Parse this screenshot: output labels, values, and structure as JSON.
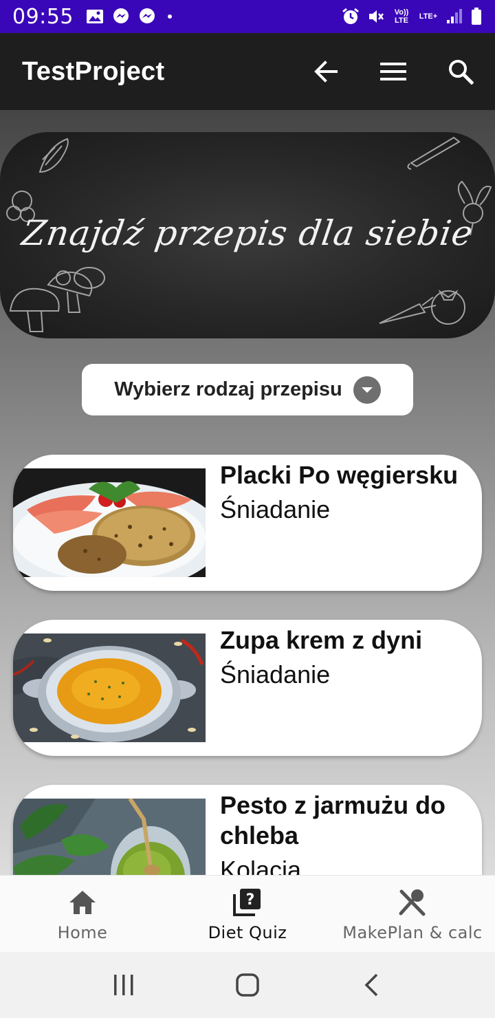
{
  "status_bar": {
    "time": "09:55",
    "network_volte": "Vo)) LTE",
    "network_lte": "LTE+"
  },
  "app_bar": {
    "title": "TestProject",
    "actions": [
      "back-arrow-icon",
      "menu-icon",
      "search-icon"
    ]
  },
  "banner": {
    "text": "Znajdź przepis dla siebie"
  },
  "recipe_type_select": {
    "label": "Wybierz rodzaj przepisu"
  },
  "recipes": [
    {
      "title": "Placki Po węgiersku",
      "category": "Śniadanie"
    },
    {
      "title": "Zupa krem z dyni",
      "category": "Śniadanie"
    },
    {
      "title": "Pesto z jarmużu do chleba",
      "category": "Kolacja"
    }
  ],
  "bottom_nav": {
    "items": [
      {
        "label": "Home",
        "icon": "home-icon",
        "active": false
      },
      {
        "label": "Diet Quiz",
        "icon": "quiz-icon",
        "active": true
      },
      {
        "label": "MakePlan & calc",
        "icon": "utensils-icon",
        "active": false
      }
    ]
  },
  "system_nav": [
    "recents-icon",
    "home-circle-icon",
    "back-chevron-icon"
  ],
  "colors": {
    "status_bar": "#3a07b8",
    "app_bar": "#1e1e1e",
    "card": "#ffffff",
    "nav_bg": "#fafafa"
  }
}
